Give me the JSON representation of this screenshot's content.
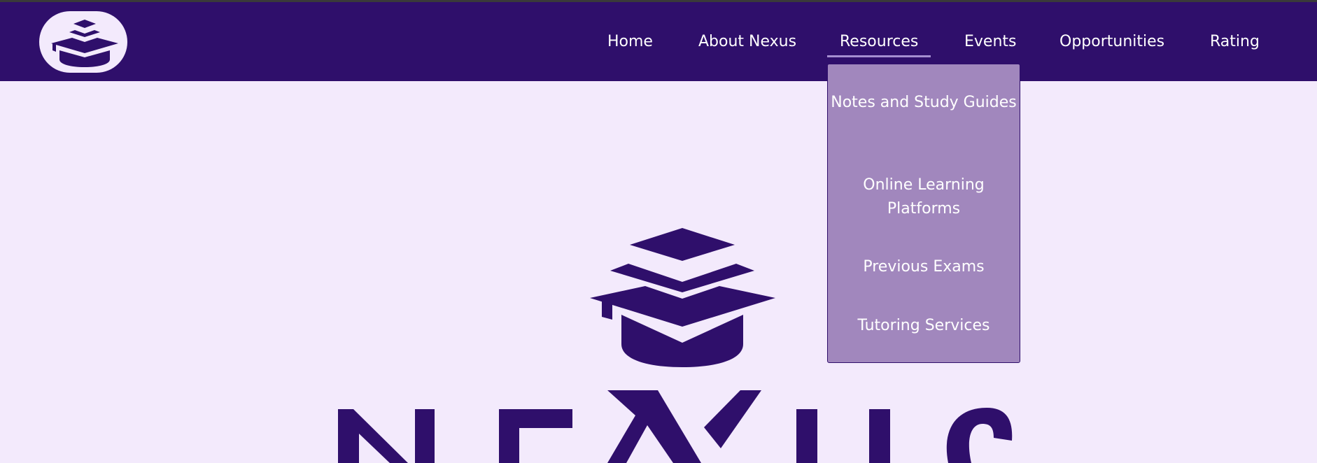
{
  "header": {
    "logo_icon": "graduation-cap-stack-icon",
    "nav": {
      "home": "Home",
      "about": "About Nexus",
      "resources": "Resources",
      "events": "Events",
      "opportunities": "Opportunities",
      "rating": "Rating"
    },
    "active_item": "Resources"
  },
  "resources_menu": {
    "items": [
      "Notes and Study Guides",
      "Online Learning Platforms",
      "Previous Exams",
      "Tutoring Services"
    ]
  },
  "hero": {
    "brand_icon": "graduation-cap-stack-icon",
    "brand_wordmark": "NEXUS"
  },
  "colors": {
    "nav_background": "#2f0f6b",
    "page_background": "#f3eafc",
    "dropdown_background": "#a187bd",
    "accent": "#2f0f6b",
    "nav_text": "#ffffff"
  }
}
